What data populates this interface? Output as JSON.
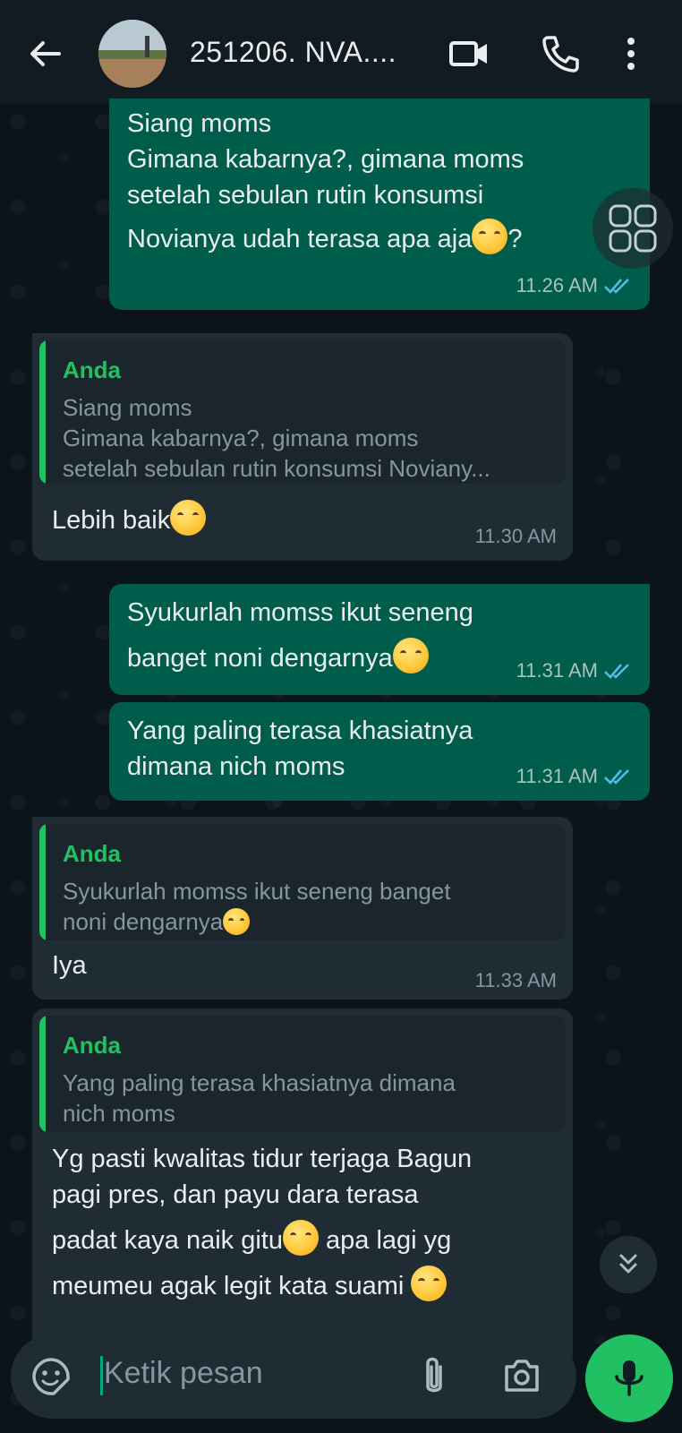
{
  "header": {
    "title": "251206. NVA....",
    "back_icon": "arrow-left-icon",
    "video_icon": "video-camera-icon",
    "call_icon": "phone-icon",
    "menu_icon": "more-vertical-icon"
  },
  "messages": [
    {
      "lines": [
        "Siang moms",
        "Gimana kabarnya?, gimana moms",
        "setelah sebulan rutin konsumsi",
        "Novianya udah terasa apa aja",
        "?"
      ],
      "time": "11.26 AM"
    },
    {
      "quote_author": "Anda",
      "quote_lines": [
        "Siang moms",
        "Gimana kabarnya?, gimana moms",
        "setelah sebulan rutin konsumsi Noviany..."
      ],
      "text": "Lebih baik",
      "time": "11.30 AM"
    },
    {
      "lines": [
        "Syukurlah momss ikut seneng",
        "banget noni dengarnya"
      ],
      "time": "11.31 AM"
    },
    {
      "lines": [
        "Yang paling terasa khasiatnya",
        "dimana nich moms"
      ],
      "time": "11.31 AM"
    },
    {
      "quote_author": "Anda",
      "quote_lines": [
        "Syukurlah momss ikut seneng banget",
        "noni dengarnya"
      ],
      "text": "Iya",
      "time": "11.33 AM"
    },
    {
      "quote_author": "Anda",
      "quote_lines": [
        "Yang paling terasa khasiatnya dimana",
        "nich moms"
      ],
      "lines": [
        "Yg pasti kwalitas tidur terjaga Bagun",
        "pagi pres, dan payu dara terasa",
        "padat kaya naik gitu",
        " apa lagi yg",
        "meumeu agak legit kata suami "
      ]
    }
  ],
  "input": {
    "placeholder": "Ketik pesan",
    "emoji_icon": "sticker-smiley-icon",
    "attach_icon": "paperclip-icon",
    "camera_icon": "camera-icon",
    "mic_icon": "microphone-icon"
  },
  "scroll_down_icon": "double-chevron-down-icon",
  "colors": {
    "outgoing": "#005c4b",
    "incoming": "#202c33",
    "accent": "#21c063",
    "read_check": "#53bdeb"
  }
}
